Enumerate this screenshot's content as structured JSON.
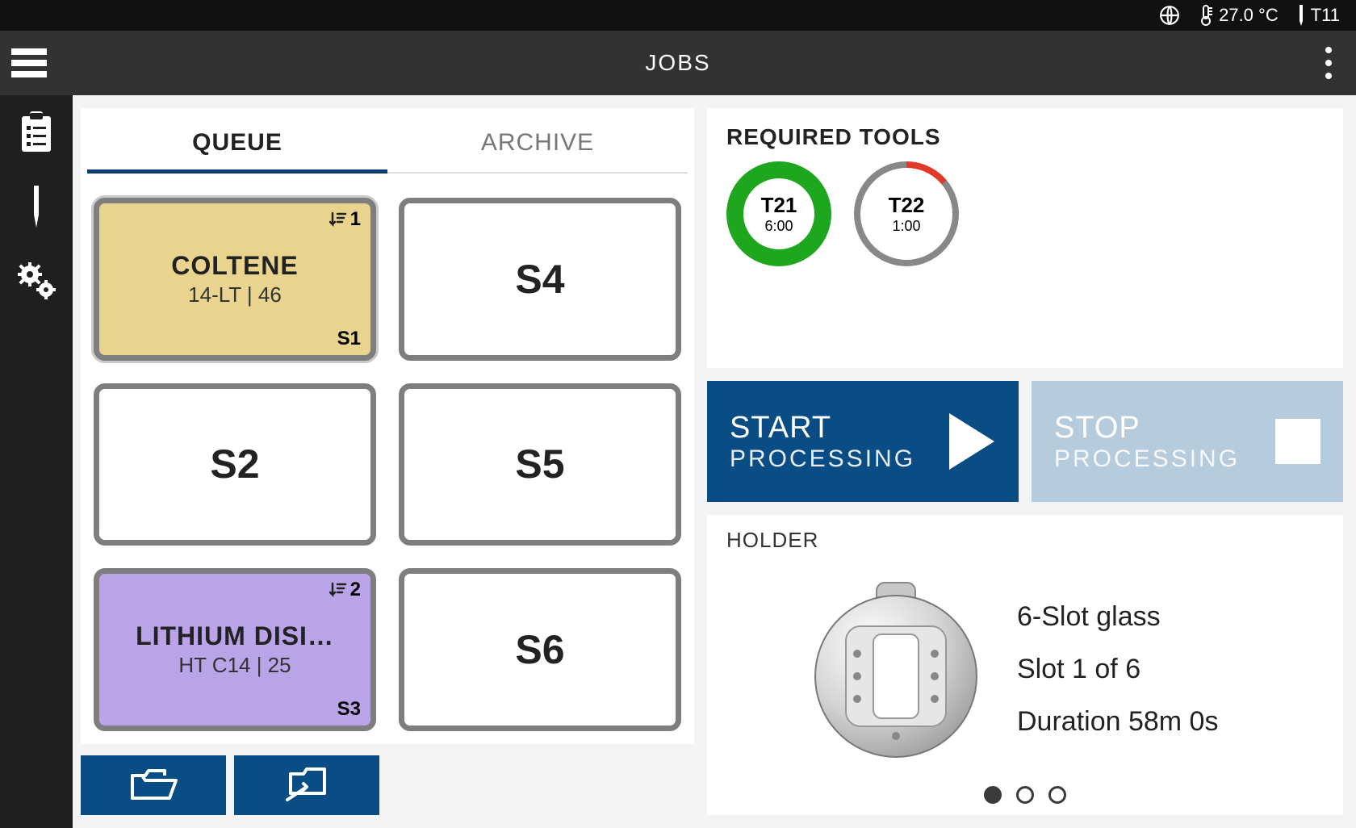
{
  "status": {
    "temperature": "27.0 °C",
    "tool": "T11"
  },
  "header": {
    "title": "JOBS"
  },
  "tabs": {
    "queue": "QUEUE",
    "archive": "ARCHIVE"
  },
  "slots": {
    "s1": {
      "title": "COLTENE",
      "sub": "14-LT | 46",
      "corner": "S1",
      "order": "1"
    },
    "s2": {
      "label": "S2"
    },
    "s3": {
      "title": "LITHIUM DISI…",
      "sub": "HT C14 | 25",
      "corner": "S3",
      "order": "2"
    },
    "s4": {
      "label": "S4"
    },
    "s5": {
      "label": "S5"
    },
    "s6": {
      "label": "S6"
    }
  },
  "tools": {
    "heading": "REQUIRED TOOLS",
    "t1": {
      "name": "T21",
      "time": "6:00"
    },
    "t2": {
      "name": "T22",
      "time": "1:00"
    }
  },
  "processing": {
    "start_l1": "START",
    "start_l2": "PROCESSING",
    "stop_l1": "STOP",
    "stop_l2": "PROCESSING"
  },
  "holder": {
    "heading": "HOLDER",
    "line1": "6-Slot glass",
    "line2": "Slot  1  of  6",
    "line3": "Duration  58m 0s"
  }
}
